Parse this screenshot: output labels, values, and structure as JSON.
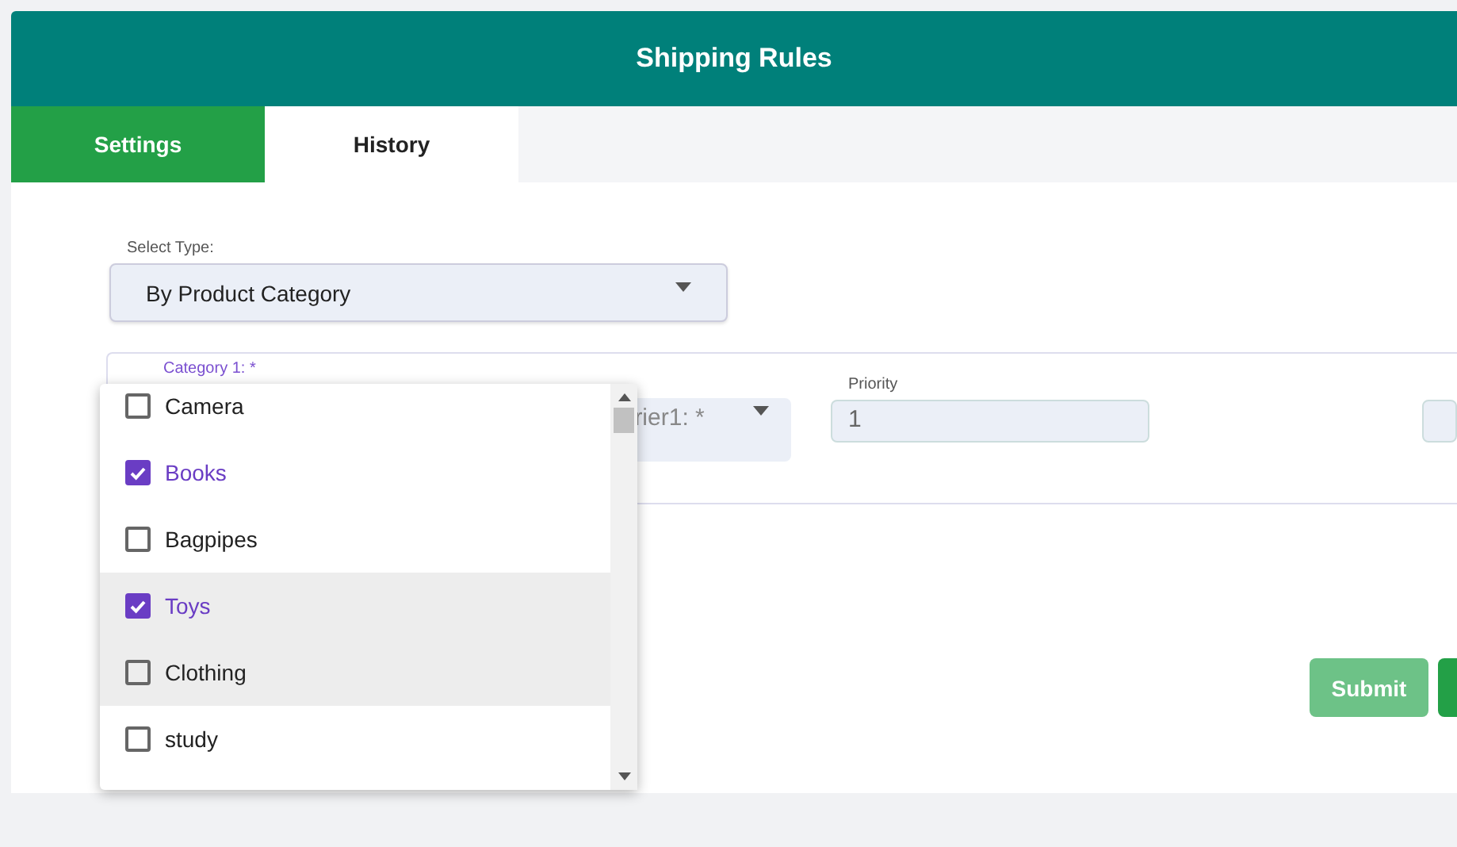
{
  "header": {
    "title": "Shipping Rules"
  },
  "tabs": [
    {
      "label": "Settings",
      "selected": true
    },
    {
      "label": "History",
      "selected": false
    }
  ],
  "select_type": {
    "label": "Select Type:",
    "value": "By Product Category"
  },
  "rule": {
    "category_label": "Category 1: *",
    "carrier_placeholder": "rier1: *",
    "priority_label": "Priority",
    "priority_value": "1"
  },
  "category_options": [
    {
      "label": "Camera",
      "checked": false,
      "hovered": false
    },
    {
      "label": "Books",
      "checked": true,
      "hovered": false
    },
    {
      "label": "Bagpipes",
      "checked": false,
      "hovered": false
    },
    {
      "label": "Toys",
      "checked": true,
      "hovered": true
    },
    {
      "label": "Clothing",
      "checked": false,
      "hovered": true
    },
    {
      "label": "study",
      "checked": false,
      "hovered": false
    }
  ],
  "buttons": [
    {
      "label": "Submit",
      "kind": "light"
    },
    {
      "kind": "solid"
    }
  ]
}
